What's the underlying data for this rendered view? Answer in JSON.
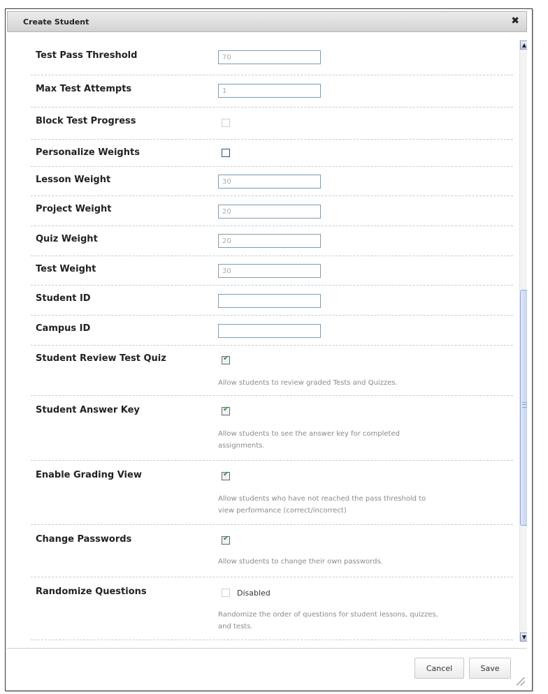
{
  "dialog": {
    "title": "Create Student",
    "close_symbol": "✖",
    "cancel_label": "Cancel",
    "save_label": "Save"
  },
  "fields": {
    "test_pass_threshold": {
      "label": "Test Pass Threshold",
      "value": "70"
    },
    "max_test_attempts": {
      "label": "Max Test Attempts",
      "value": "1"
    },
    "block_test_progress": {
      "label": "Block Test Progress",
      "checked": false,
      "enabled": false
    },
    "personalize_weights": {
      "label": "Personalize Weights",
      "checked": false,
      "enabled": true
    },
    "lesson_weight": {
      "label": "Lesson Weight",
      "value": "30"
    },
    "project_weight": {
      "label": "Project Weight",
      "value": "20"
    },
    "quiz_weight": {
      "label": "Quiz Weight",
      "value": "20"
    },
    "test_weight": {
      "label": "Test Weight",
      "value": "30"
    },
    "student_id": {
      "label": "Student ID",
      "value": ""
    },
    "campus_id": {
      "label": "Campus ID",
      "value": ""
    },
    "student_review_test_quiz": {
      "label": "Student Review Test Quiz",
      "checked": true,
      "help": "Allow students to review graded Tests and Quizzes."
    },
    "student_answer_key": {
      "label": "Student Answer Key",
      "checked": true,
      "help_line1": "Allow students to see the answer key for completed",
      "help_line2": "assignments."
    },
    "enable_grading_view": {
      "label": "Enable Grading View",
      "checked": true,
      "help_line1": "Allow students who have not reached the pass threshold to",
      "help_line2": "view performance (correct/incorrect)"
    },
    "change_passwords": {
      "label": "Change Passwords",
      "checked": true,
      "help": "Allow students to change their own passwords."
    },
    "randomize_questions": {
      "label": "Randomize Questions",
      "checked": false,
      "enabled": false,
      "status": "Disabled",
      "help_line1": "Randomize the order of questions for student lessons, quizzes,",
      "help_line2": "and tests."
    }
  },
  "colors": {
    "checkmark": "#2f8a2f",
    "input_border": "#7a9cb6",
    "scroll_thumb": "#c2d2f2"
  }
}
